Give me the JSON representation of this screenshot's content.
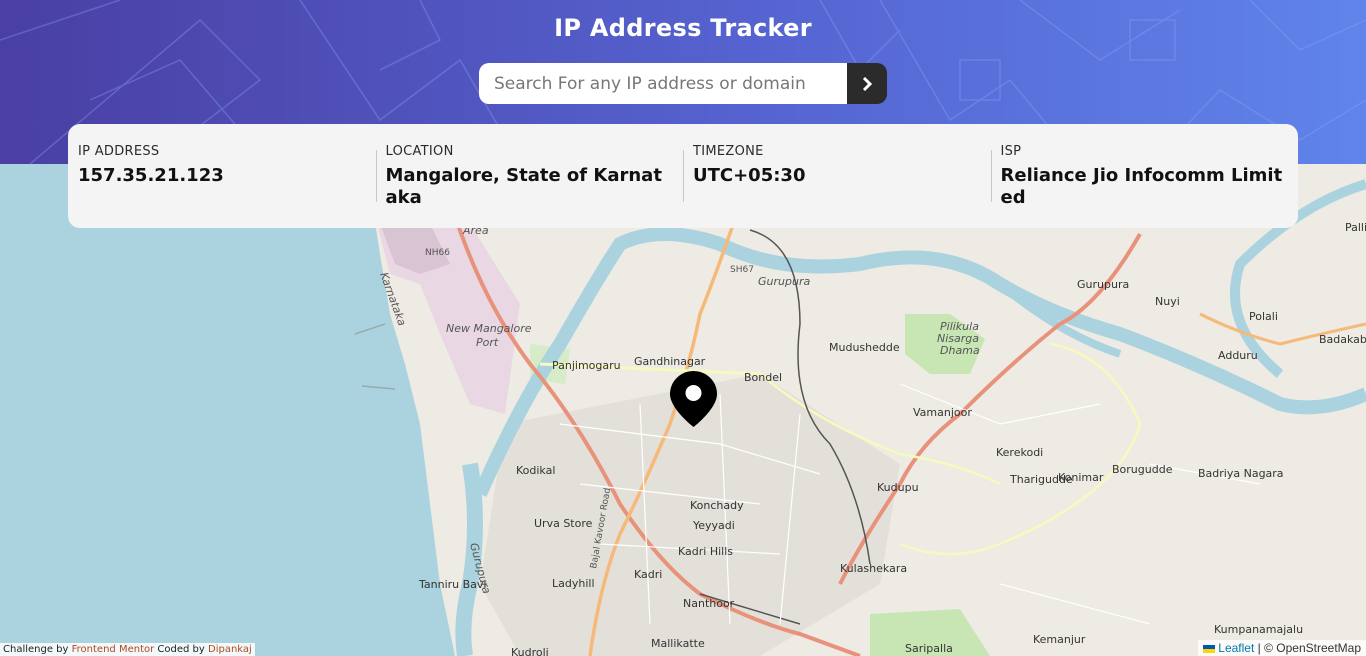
{
  "header": {
    "title": "IP Address Tracker",
    "search_placeholder": "Search For any IP address or domain",
    "search_value": ""
  },
  "info": [
    {
      "label": "IP ADDRESS",
      "value": "157.35.21.123"
    },
    {
      "label": "LOCATION",
      "value": "Mangalore, State of Karnataka"
    },
    {
      "label": "TIMEZONE",
      "value": "UTC+05:30"
    },
    {
      "label": "ISP",
      "value": "Reliance Jio Infocomm Limited"
    }
  ],
  "map": {
    "places": [
      "Area",
      "NH66",
      "SH67",
      "Gurupura",
      "Karnataka",
      "New Mangalore",
      "Port",
      "Panjimogaru",
      "Gandhinagar",
      "Bondel",
      "Mudushedde",
      "Pilikula",
      "Nisarga",
      "Dhama",
      "Gurupura",
      "Nuyi",
      "Polali",
      "Adduru",
      "Badakaba",
      "Palli",
      "Vamanjoor",
      "Kerekodi",
      "Tharigudde",
      "Konimar",
      "Boruguddе",
      "Badriya Nagara",
      "Kodikal",
      "Konchady",
      "Yeyyadi",
      "Kudupu",
      "Urva Store",
      "Kadri Hills",
      "Kulashekara",
      "Tanniru Bavi",
      "Ladyhill",
      "Kadri",
      "Nanthoor",
      "Mallikatte",
      "Kudroli",
      "Saripalla",
      "Kemanjur",
      "Kumpanamajalu",
      "Bajal Kavoor Road",
      "Gurupura"
    ]
  },
  "footer": {
    "challenge_by": "Challenge by",
    "frontend_mentor": "Frontend Mentor",
    "coded_by": "Coded by",
    "author": "Dipankaj"
  },
  "attribution": {
    "leaflet": "Leaflet",
    "separator": "|",
    "osm": "© OpenStreetMap"
  },
  "icons": {
    "search": "chevron-right-icon",
    "marker": "location-pin-icon"
  },
  "colors": {
    "hero_start": "#4a3fa3",
    "hero_end": "#5f84ea",
    "card_bg": "#f4f4f4",
    "button": "#2b2b2b"
  }
}
